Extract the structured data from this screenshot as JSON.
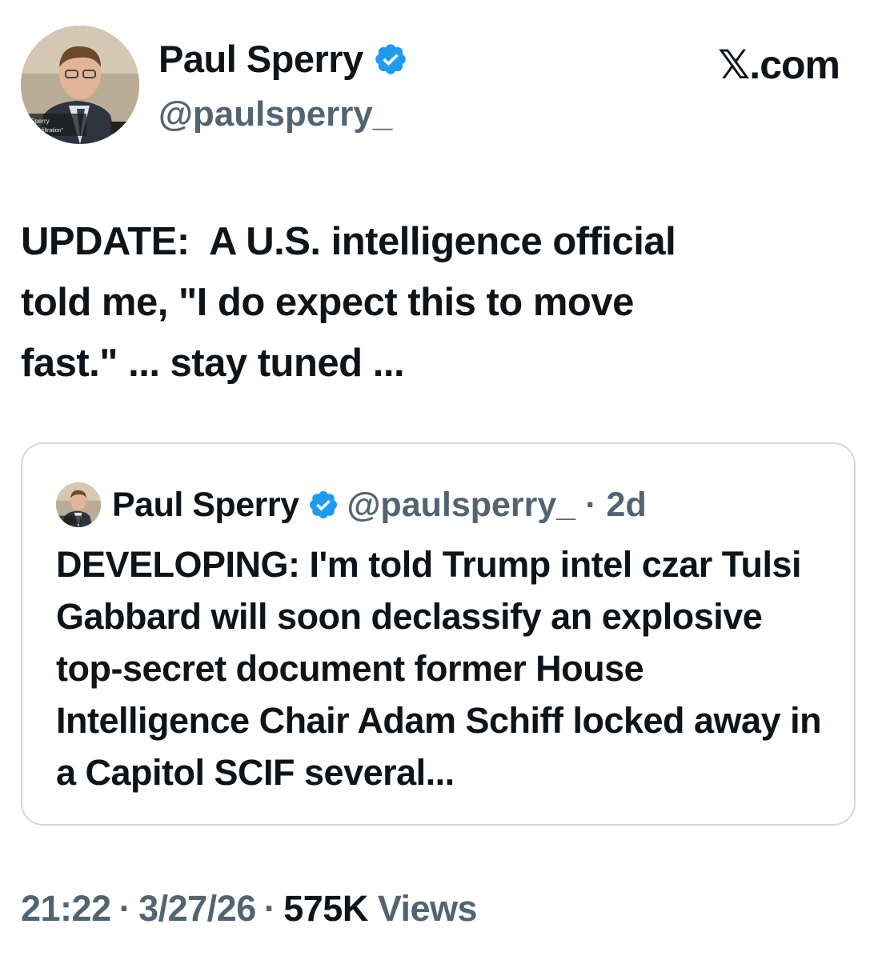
{
  "author": {
    "display_name": "Paul Sperry",
    "handle": "@paulsperry_",
    "verified_icon": "verified-badge-icon",
    "avatar_caption_line1": "l Sperry",
    "avatar_caption_line2": "or, \"Infiltration\""
  },
  "site_label": "𝕏.com",
  "tweet": {
    "text": "UPDATE:  A U.S. intelligence official\ntold me, \"I do expect this to move\nfast.\" ... stay tuned ..."
  },
  "quoted_tweet": {
    "display_name": "Paul Sperry",
    "handle": "@paulsperry_",
    "separator": "·",
    "time": "2d",
    "text": "DEVELOPING: I'm told Trump intel czar Tulsi Gabbard will soon declassify an explosive top-secret document former House Intelligence Chair Adam Schiff locked away in a Capitol SCIF several..."
  },
  "meta": {
    "time": "21:22",
    "sep1": "·",
    "date": "3/27/26",
    "sep2": "·",
    "views_count": "575K",
    "views_label": "Views"
  },
  "colors": {
    "text_primary": "#0f1419",
    "text_secondary": "#536471",
    "verified_blue": "#1d9bf0",
    "border": "#cfd9de"
  }
}
